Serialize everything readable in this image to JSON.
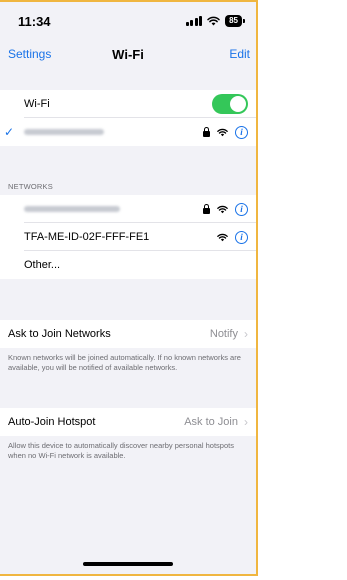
{
  "status_bar": {
    "time": "11:34",
    "battery": "85"
  },
  "nav": {
    "back_label": "Settings",
    "title": "Wi-Fi",
    "edit_label": "Edit"
  },
  "wifi_group": {
    "wifi_label": "Wi-Fi",
    "wifi_enabled": true,
    "connected_network_name_redacted": true
  },
  "networks_section": {
    "header": "NETWORKS",
    "items": [
      {
        "name_redacted": true,
        "locked": true,
        "label": ""
      },
      {
        "label": "TFA-ME-ID-02F-FFF-FE1",
        "locked": false
      },
      {
        "label": "Other..."
      }
    ]
  },
  "ask_to_join": {
    "label": "Ask to Join Networks",
    "value": "Notify",
    "footnote": "Known networks will be joined automatically. If no known networks are available, you will be notified of available networks."
  },
  "auto_join_hotspot": {
    "label": "Auto-Join Hotspot",
    "value": "Ask to Join",
    "footnote": "Allow this device to automatically discover nearby personal hotspots when no Wi-Fi network is available."
  },
  "colors": {
    "accent": "#1a73e8",
    "toggle_on": "#34c759",
    "background": "#f2f2f7",
    "frame_border": "#f0b640"
  }
}
